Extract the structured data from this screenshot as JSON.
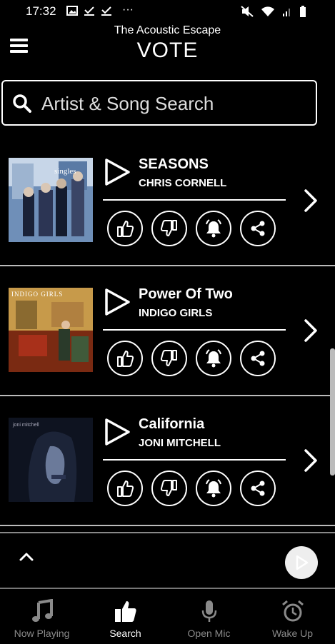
{
  "status_bar": {
    "time": "17:32",
    "more": "···"
  },
  "header": {
    "subtitle": "The Acoustic Escape",
    "title": "VOTE"
  },
  "search": {
    "placeholder": "Artist & Song Search"
  },
  "songs": [
    {
      "title": "SEASONS",
      "artist": "CHRIS CORNELL",
      "cover_text": "singles"
    },
    {
      "title": "Power Of Two",
      "artist": "INDIGO GIRLS",
      "cover_text": "INDIGO GIRLS"
    },
    {
      "title": "California",
      "artist": "JONI MITCHELL",
      "cover_text": "joni mitchell"
    }
  ],
  "tabs": [
    {
      "label": "Now Playing",
      "icon": "music-note-icon",
      "active": false
    },
    {
      "label": "Search",
      "icon": "thumbs-up-icon",
      "active": true
    },
    {
      "label": "Open Mic",
      "icon": "microphone-icon",
      "active": false
    },
    {
      "label": "Wake Up",
      "icon": "alarm-clock-icon",
      "active": false
    }
  ],
  "colors": {
    "background": "#000000",
    "foreground": "#ffffff",
    "inactive_tab": "#8a8a8a"
  }
}
